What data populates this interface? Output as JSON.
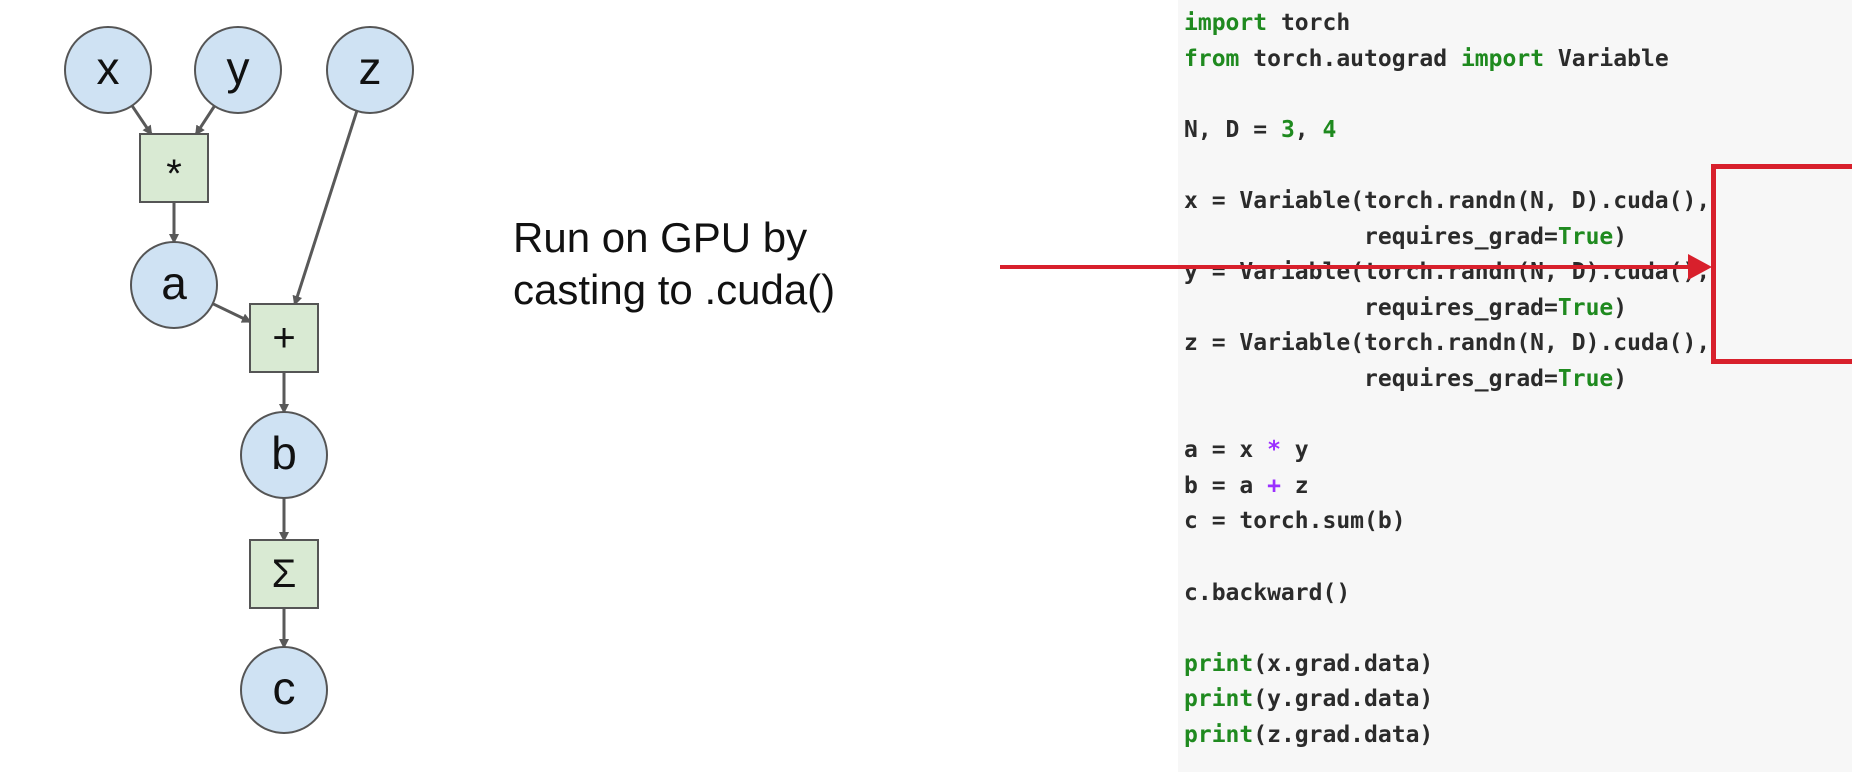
{
  "graph": {
    "nodes": [
      {
        "id": "x",
        "label": "x"
      },
      {
        "id": "y",
        "label": "y"
      },
      {
        "id": "z",
        "label": "z"
      },
      {
        "id": "a",
        "label": "a"
      },
      {
        "id": "b",
        "label": "b"
      },
      {
        "id": "c",
        "label": "c"
      }
    ],
    "ops": [
      {
        "id": "mul",
        "label": "*"
      },
      {
        "id": "add",
        "label": "+"
      },
      {
        "id": "sum",
        "label": "Σ"
      }
    ],
    "edges": [
      [
        "x",
        "mul"
      ],
      [
        "y",
        "mul"
      ],
      [
        "mul",
        "a"
      ],
      [
        "a",
        "add"
      ],
      [
        "z",
        "add"
      ],
      [
        "add",
        "b"
      ],
      [
        "b",
        "sum"
      ],
      [
        "sum",
        "c"
      ]
    ],
    "colors": {
      "node_fill": "#cfe2f3",
      "op_fill": "#d9ead3",
      "edge": "#595959",
      "stroke": "#555555"
    }
  },
  "caption": {
    "line1": "Run on GPU by",
    "line2": "casting to .cuda()"
  },
  "annotation_color": "#d8202c",
  "code": {
    "lines": [
      [
        {
          "t": "import",
          "c": "kw"
        },
        {
          "t": " torch"
        }
      ],
      [
        {
          "t": "from",
          "c": "kw"
        },
        {
          "t": " torch.autograd "
        },
        {
          "t": "import",
          "c": "kw"
        },
        {
          "t": " Variable"
        }
      ],
      [],
      [
        {
          "t": "N, D = "
        },
        {
          "t": "3",
          "c": "num"
        },
        {
          "t": ", "
        },
        {
          "t": "4",
          "c": "num"
        }
      ],
      [],
      [
        {
          "t": "x = Variable(torch.randn(N, D).cuda(),"
        }
      ],
      [
        {
          "t": "             requires_grad="
        },
        {
          "t": "True",
          "c": "kwarg"
        },
        {
          "t": ")"
        }
      ],
      [
        {
          "t": "y = Variable(torch.randn(N, D).cuda(),"
        }
      ],
      [
        {
          "t": "             requires_grad="
        },
        {
          "t": "True",
          "c": "kwarg"
        },
        {
          "t": ")"
        }
      ],
      [
        {
          "t": "z = Variable(torch.randn(N, D).cuda(),"
        }
      ],
      [
        {
          "t": "             requires_grad="
        },
        {
          "t": "True",
          "c": "kwarg"
        },
        {
          "t": ")"
        }
      ],
      [],
      [
        {
          "t": "a = x "
        },
        {
          "t": "*",
          "c": "op"
        },
        {
          "t": " y"
        }
      ],
      [
        {
          "t": "b = a "
        },
        {
          "t": "+",
          "c": "op"
        },
        {
          "t": " z"
        }
      ],
      [
        {
          "t": "c = torch.sum(b)"
        }
      ],
      [],
      [
        {
          "t": "c.backward()"
        }
      ],
      [],
      [
        {
          "t": "print",
          "c": "kw"
        },
        {
          "t": "(x.grad.data)"
        }
      ],
      [
        {
          "t": "print",
          "c": "kw"
        },
        {
          "t": "(y.grad.data)"
        }
      ],
      [
        {
          "t": "print",
          "c": "kw"
        },
        {
          "t": "(z.grad.data)"
        }
      ]
    ]
  }
}
